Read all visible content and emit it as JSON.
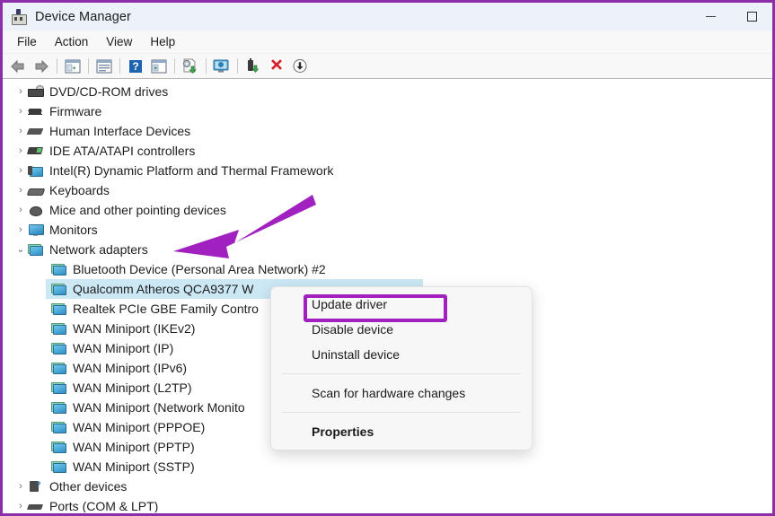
{
  "window": {
    "title": "Device Manager",
    "app_icon": "device-manager-icon",
    "controls": {
      "minimize": "minimize-icon",
      "maximize": "maximize-icon"
    }
  },
  "menubar": {
    "items": [
      {
        "label": "File"
      },
      {
        "label": "Action"
      },
      {
        "label": "View"
      },
      {
        "label": "Help"
      }
    ]
  },
  "toolbar": {
    "items": [
      {
        "icon": "back-arrow-icon"
      },
      {
        "icon": "forward-arrow-icon"
      },
      {
        "separator": true
      },
      {
        "icon": "show-hide-console-tree-icon"
      },
      {
        "separator": true
      },
      {
        "icon": "properties-icon"
      },
      {
        "separator": true
      },
      {
        "icon": "help-icon"
      },
      {
        "icon": "show-hide-action-pane-icon"
      },
      {
        "separator": true
      },
      {
        "icon": "update-driver-icon"
      },
      {
        "separator": true
      },
      {
        "icon": "scan-for-hardware-changes-icon"
      },
      {
        "separator": true
      },
      {
        "icon": "enable-device-icon"
      },
      {
        "icon": "uninstall-device-icon"
      },
      {
        "icon": "download-icon"
      }
    ]
  },
  "tree": {
    "items": [
      {
        "label": "DVD/CD-ROM drives",
        "level": 1,
        "expanded": false,
        "icon": "dvd-drive-icon",
        "selected": false
      },
      {
        "label": "Firmware",
        "level": 1,
        "expanded": false,
        "icon": "firmware-icon",
        "selected": false
      },
      {
        "label": "Human Interface Devices",
        "level": 1,
        "expanded": false,
        "icon": "hid-icon",
        "selected": false
      },
      {
        "label": "IDE ATA/ATAPI controllers",
        "level": 1,
        "expanded": false,
        "icon": "ide-controller-icon",
        "selected": false
      },
      {
        "label": "Intel(R) Dynamic Platform and Thermal Framework",
        "level": 1,
        "expanded": false,
        "icon": "platform-icon",
        "selected": false
      },
      {
        "label": "Keyboards",
        "level": 1,
        "expanded": false,
        "icon": "keyboard-icon",
        "selected": false
      },
      {
        "label": "Mice and other pointing devices",
        "level": 1,
        "expanded": false,
        "icon": "mouse-icon",
        "selected": false
      },
      {
        "label": "Monitors",
        "level": 1,
        "expanded": false,
        "icon": "monitor-icon",
        "selected": false
      },
      {
        "label": "Network adapters",
        "level": 1,
        "expanded": true,
        "icon": "network-adapter-icon",
        "selected": false
      },
      {
        "label": "Bluetooth Device (Personal Area Network) #2",
        "level": 2,
        "expanded": null,
        "icon": "network-adapter-icon",
        "selected": false
      },
      {
        "label": "Qualcomm Atheros QCA9377 W",
        "level": 2,
        "expanded": null,
        "icon": "network-adapter-icon",
        "selected": true
      },
      {
        "label": "Realtek PCIe GBE Family Contro",
        "level": 2,
        "expanded": null,
        "icon": "network-adapter-icon",
        "selected": false
      },
      {
        "label": "WAN Miniport (IKEv2)",
        "level": 2,
        "expanded": null,
        "icon": "network-adapter-icon",
        "selected": false
      },
      {
        "label": "WAN Miniport (IP)",
        "level": 2,
        "expanded": null,
        "icon": "network-adapter-icon",
        "selected": false
      },
      {
        "label": "WAN Miniport (IPv6)",
        "level": 2,
        "expanded": null,
        "icon": "network-adapter-icon",
        "selected": false
      },
      {
        "label": "WAN Miniport (L2TP)",
        "level": 2,
        "expanded": null,
        "icon": "network-adapter-icon",
        "selected": false
      },
      {
        "label": "WAN Miniport (Network Monito",
        "level": 2,
        "expanded": null,
        "icon": "network-adapter-icon",
        "selected": false
      },
      {
        "label": "WAN Miniport (PPPOE)",
        "level": 2,
        "expanded": null,
        "icon": "network-adapter-icon",
        "selected": false
      },
      {
        "label": "WAN Miniport (PPTP)",
        "level": 2,
        "expanded": null,
        "icon": "network-adapter-icon",
        "selected": false
      },
      {
        "label": "WAN Miniport (SSTP)",
        "level": 2,
        "expanded": null,
        "icon": "network-adapter-icon",
        "selected": false
      },
      {
        "label": "Other devices",
        "level": 1,
        "expanded": false,
        "icon": "other-devices-icon",
        "selected": false
      },
      {
        "label": "Ports (COM & LPT)",
        "level": 1,
        "expanded": false,
        "icon": "ports-icon",
        "selected": false
      }
    ]
  },
  "context_menu": {
    "items": [
      {
        "label": "Update driver",
        "type": "item",
        "highlighted": true,
        "bold": false
      },
      {
        "label": "Disable device",
        "type": "item",
        "highlighted": false,
        "bold": false
      },
      {
        "label": "Uninstall device",
        "type": "item",
        "highlighted": false,
        "bold": false
      },
      {
        "type": "separator"
      },
      {
        "label": "Scan for hardware changes",
        "type": "item",
        "highlighted": false,
        "bold": false
      },
      {
        "type": "separator"
      },
      {
        "label": "Properties",
        "type": "item",
        "highlighted": false,
        "bold": true
      }
    ]
  },
  "annotations": {
    "arrow": {
      "name": "pointer-arrow",
      "color": "#a020c0",
      "points_to": "Network adapters"
    },
    "highlight_box": {
      "name": "update-driver-highlight-box",
      "color": "#a020c0",
      "around": "Update driver"
    }
  },
  "colors": {
    "border": "#8a2fa8",
    "titlebar_bg": "#edf1fa",
    "selection_bg": "#cce8f5",
    "accent_purple": "#a020c0"
  }
}
